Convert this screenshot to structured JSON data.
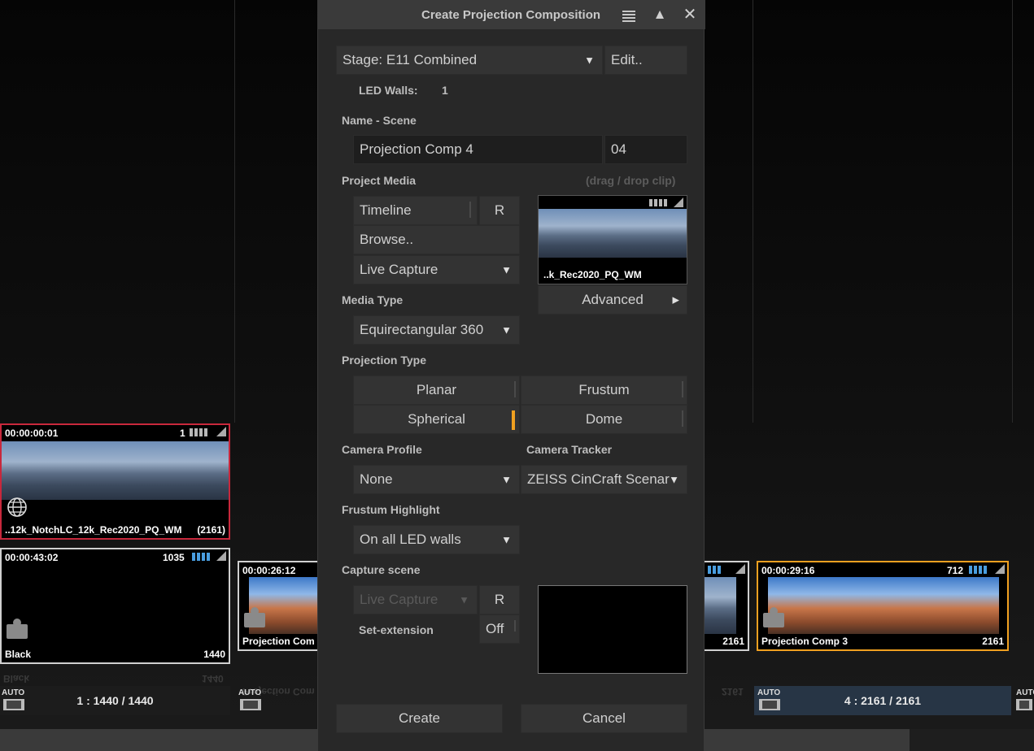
{
  "background_clips": {
    "clip_selected": {
      "timecode": "00:00:00:01",
      "count": "1",
      "name": "..12k_NotchLC_12k_Rec2020_PQ_WM",
      "number": "(2161)"
    },
    "clip_black": {
      "timecode": "00:00:43:02",
      "count": "1035",
      "name": "Black",
      "number": "1440"
    },
    "clip_comp_partial": {
      "timecode": "00:00:26:12",
      "name": "Projection Com"
    },
    "clip_comp_right_partial": {
      "number": "2161"
    },
    "clip_comp3": {
      "timecode": "00:00:29:16",
      "count": "712",
      "name": "Projection Comp 3",
      "number": "2161"
    },
    "reflections": {
      "black_name": "Black",
      "black_num": "1440",
      "comp_name": "Projection Com",
      "right_num": "2161"
    },
    "auto_label": "AUTO",
    "counter_left": "1 : 1440 / 1440",
    "counter_right": "4 : 2161 / 2161"
  },
  "dialog": {
    "title": "Create Projection Composition",
    "stage_value": "Stage: E11 Combined",
    "edit_button": "Edit..",
    "led_walls_label": "LED Walls:",
    "led_walls_value": "1",
    "name_scene_label": "Name - Scene",
    "name_value": "Projection Comp 4",
    "scene_value": "04",
    "project_media_label": "Project Media",
    "drag_hint": "(drag / drop clip)",
    "timeline_button": "Timeline",
    "r_button": "R",
    "browse_button": "Browse..",
    "live_capture_value": "Live Capture",
    "preview_name": "..k_Rec2020_PQ_WM",
    "advanced_button": "Advanced",
    "media_type_label": "Media Type",
    "media_type_value": "Equirectangular 360",
    "projection_type_label": "Projection Type",
    "projection_options": [
      "Planar",
      "Frustum",
      "Spherical",
      "Dome"
    ],
    "selected_projection": "Spherical",
    "camera_profile_label": "Camera Profile",
    "camera_profile_value": "None",
    "camera_tracker_label": "Camera Tracker",
    "camera_tracker_value": "ZEISS CinCraft Scenar",
    "frustum_highlight_label": "Frustum Highlight",
    "frustum_highlight_value": "On all LED walls",
    "capture_scene_label": "Capture scene",
    "capture_live_value": "Live Capture",
    "capture_r_button": "R",
    "set_extension_label": "Set-extension",
    "set_extension_value": "Off",
    "create_button": "Create",
    "cancel_button": "Cancel"
  },
  "colors": {
    "accent": "#f0a020",
    "selected_border": "#c8283c",
    "dialog_bg": "#282828"
  }
}
